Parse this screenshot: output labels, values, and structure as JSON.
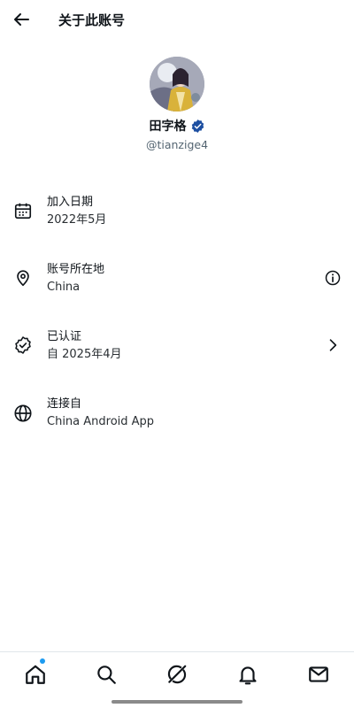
{
  "header": {
    "title": "关于此账号",
    "back_icon": "arrow-left-icon"
  },
  "profile": {
    "display_name": "田字格",
    "handle": "@tianzige4",
    "verified_color": "#1d4fa1"
  },
  "rows": [
    {
      "icon": "calendar-icon",
      "label": "加入日期",
      "value": "2022年5月"
    },
    {
      "icon": "location-pin-icon",
      "label": "账号所在地",
      "value": "China",
      "trailing": "info-icon"
    },
    {
      "icon": "verified-badge-outline-icon",
      "label": "已认证",
      "value": "自 2025年4月",
      "trailing": "chevron-right-icon"
    },
    {
      "icon": "globe-icon",
      "label": "连接自",
      "value": "China Android App"
    }
  ],
  "bottom_nav": {
    "items": [
      "home-icon",
      "search-icon",
      "grok-icon",
      "bell-icon",
      "mail-icon"
    ],
    "home_badge_color": "#1d9bf0"
  }
}
